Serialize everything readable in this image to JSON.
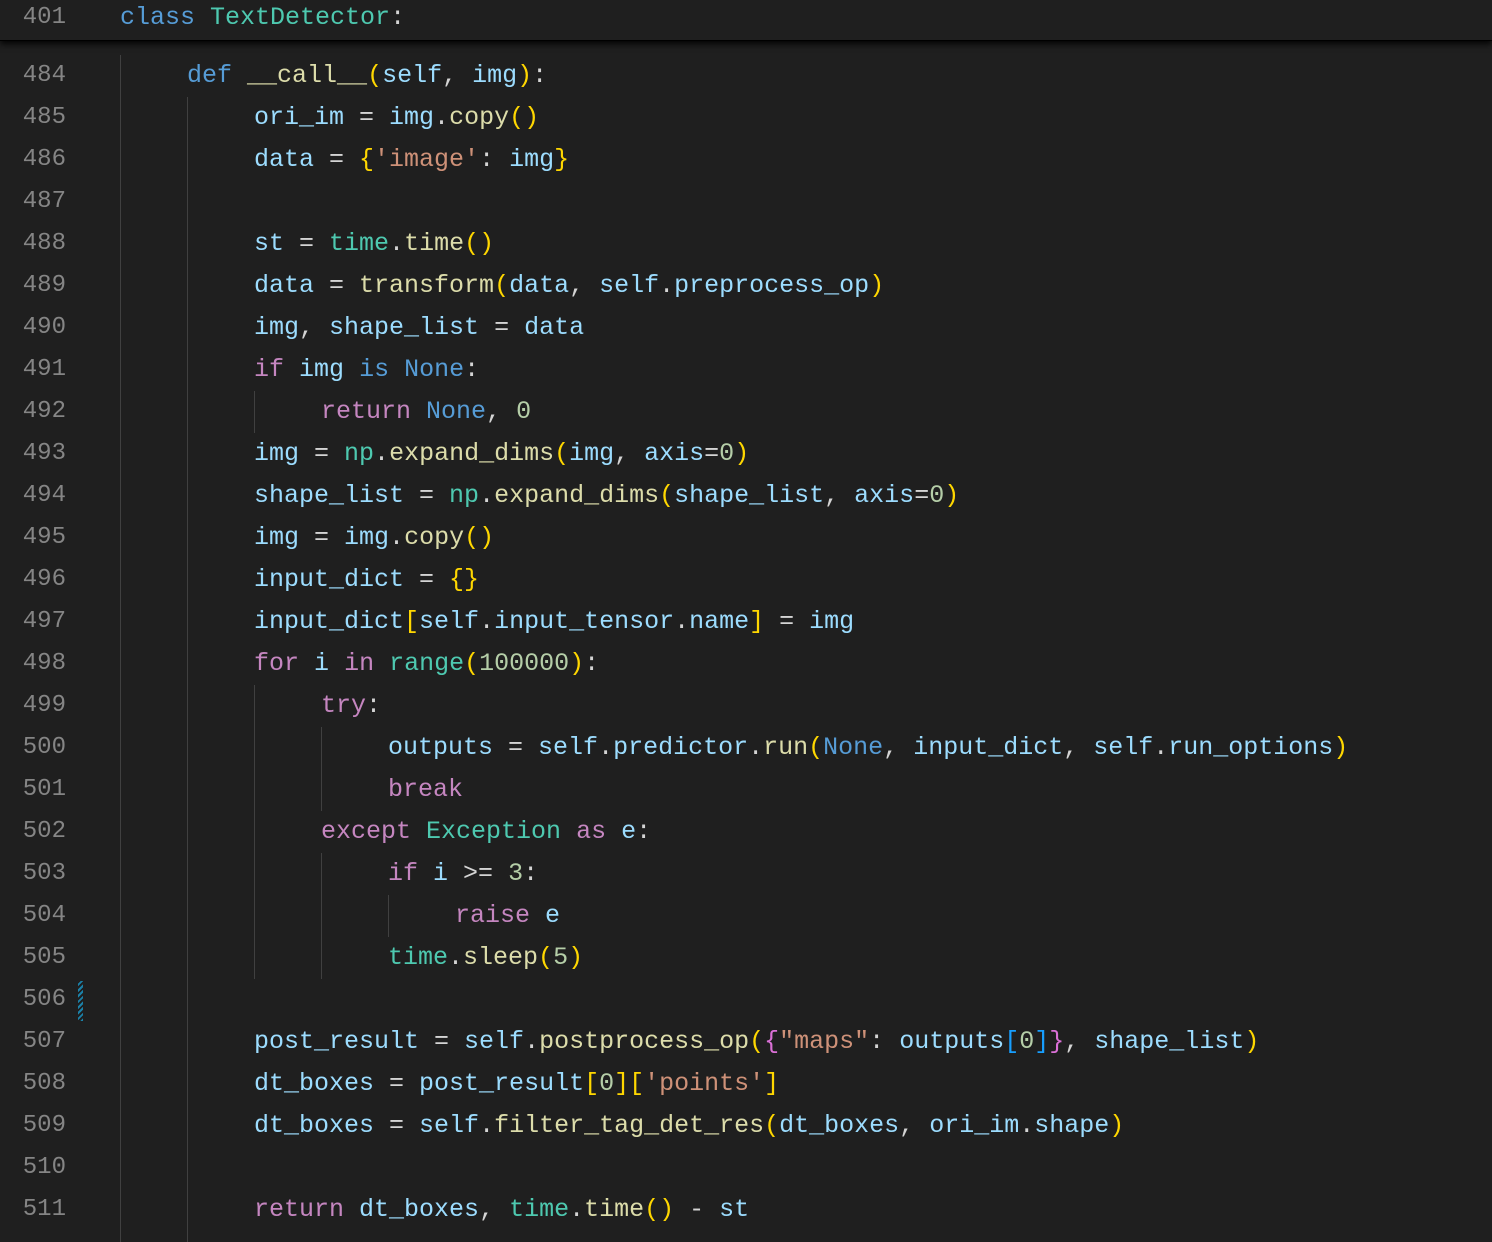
{
  "editor": {
    "sticky": [
      {
        "num": "401",
        "indent": 0,
        "tokens": [
          [
            "kb",
            "class"
          ],
          [
            "p",
            " "
          ],
          [
            "c",
            "TextDetector"
          ],
          [
            "p",
            ":"
          ]
        ]
      }
    ],
    "lines": [
      {
        "num": "484",
        "indent": 1,
        "tokens": [
          [
            "kb",
            "def"
          ],
          [
            "p",
            " "
          ],
          [
            "f",
            "__call__"
          ],
          [
            "b1",
            "("
          ],
          [
            "v",
            "self"
          ],
          [
            "p",
            ", "
          ],
          [
            "v",
            "img"
          ],
          [
            "b1",
            ")"
          ],
          [
            "p",
            ":"
          ]
        ]
      },
      {
        "num": "485",
        "indent": 2,
        "tokens": [
          [
            "v",
            "ori_im"
          ],
          [
            "p",
            " = "
          ],
          [
            "v",
            "img"
          ],
          [
            "p",
            "."
          ],
          [
            "f",
            "copy"
          ],
          [
            "b1",
            "()"
          ]
        ]
      },
      {
        "num": "486",
        "indent": 2,
        "tokens": [
          [
            "v",
            "data"
          ],
          [
            "p",
            " = "
          ],
          [
            "b1",
            "{"
          ],
          [
            "s",
            "'image'"
          ],
          [
            "p",
            ": "
          ],
          [
            "v",
            "img"
          ],
          [
            "b1",
            "}"
          ]
        ]
      },
      {
        "num": "487",
        "indent": 0,
        "tokens": []
      },
      {
        "num": "488",
        "indent": 2,
        "tokens": [
          [
            "v",
            "st"
          ],
          [
            "p",
            " = "
          ],
          [
            "c",
            "time"
          ],
          [
            "p",
            "."
          ],
          [
            "f",
            "time"
          ],
          [
            "b1",
            "()"
          ]
        ]
      },
      {
        "num": "489",
        "indent": 2,
        "tokens": [
          [
            "v",
            "data"
          ],
          [
            "p",
            " = "
          ],
          [
            "f",
            "transform"
          ],
          [
            "b1",
            "("
          ],
          [
            "v",
            "data"
          ],
          [
            "p",
            ", "
          ],
          [
            "v",
            "self"
          ],
          [
            "p",
            "."
          ],
          [
            "v",
            "preprocess_op"
          ],
          [
            "b1",
            ")"
          ]
        ]
      },
      {
        "num": "490",
        "indent": 2,
        "tokens": [
          [
            "v",
            "img"
          ],
          [
            "p",
            ", "
          ],
          [
            "v",
            "shape_list"
          ],
          [
            "p",
            " = "
          ],
          [
            "v",
            "data"
          ]
        ]
      },
      {
        "num": "491",
        "indent": 2,
        "tokens": [
          [
            "k",
            "if"
          ],
          [
            "p",
            " "
          ],
          [
            "v",
            "img"
          ],
          [
            "p",
            " "
          ],
          [
            "kb",
            "is"
          ],
          [
            "p",
            " "
          ],
          [
            "kb",
            "None"
          ],
          [
            "p",
            ":"
          ]
        ]
      },
      {
        "num": "492",
        "indent": 3,
        "tokens": [
          [
            "k",
            "return"
          ],
          [
            "p",
            " "
          ],
          [
            "kb",
            "None"
          ],
          [
            "p",
            ", "
          ],
          [
            "n",
            "0"
          ]
        ]
      },
      {
        "num": "493",
        "indent": 2,
        "tokens": [
          [
            "v",
            "img"
          ],
          [
            "p",
            " = "
          ],
          [
            "c",
            "np"
          ],
          [
            "p",
            "."
          ],
          [
            "f",
            "expand_dims"
          ],
          [
            "b1",
            "("
          ],
          [
            "v",
            "img"
          ],
          [
            "p",
            ", "
          ],
          [
            "v",
            "axis"
          ],
          [
            "p",
            "="
          ],
          [
            "n",
            "0"
          ],
          [
            "b1",
            ")"
          ]
        ]
      },
      {
        "num": "494",
        "indent": 2,
        "tokens": [
          [
            "v",
            "shape_list"
          ],
          [
            "p",
            " = "
          ],
          [
            "c",
            "np"
          ],
          [
            "p",
            "."
          ],
          [
            "f",
            "expand_dims"
          ],
          [
            "b1",
            "("
          ],
          [
            "v",
            "shape_list"
          ],
          [
            "p",
            ", "
          ],
          [
            "v",
            "axis"
          ],
          [
            "p",
            "="
          ],
          [
            "n",
            "0"
          ],
          [
            "b1",
            ")"
          ]
        ]
      },
      {
        "num": "495",
        "indent": 2,
        "tokens": [
          [
            "v",
            "img"
          ],
          [
            "p",
            " = "
          ],
          [
            "v",
            "img"
          ],
          [
            "p",
            "."
          ],
          [
            "f",
            "copy"
          ],
          [
            "b1",
            "()"
          ]
        ]
      },
      {
        "num": "496",
        "indent": 2,
        "tokens": [
          [
            "v",
            "input_dict"
          ],
          [
            "p",
            " = "
          ],
          [
            "b1",
            "{}"
          ]
        ]
      },
      {
        "num": "497",
        "indent": 2,
        "tokens": [
          [
            "v",
            "input_dict"
          ],
          [
            "b1",
            "["
          ],
          [
            "v",
            "self"
          ],
          [
            "p",
            "."
          ],
          [
            "v",
            "input_tensor"
          ],
          [
            "p",
            "."
          ],
          [
            "v",
            "name"
          ],
          [
            "b1",
            "]"
          ],
          [
            "p",
            " = "
          ],
          [
            "v",
            "img"
          ]
        ]
      },
      {
        "num": "498",
        "indent": 2,
        "tokens": [
          [
            "k",
            "for"
          ],
          [
            "p",
            " "
          ],
          [
            "v",
            "i"
          ],
          [
            "p",
            " "
          ],
          [
            "k",
            "in"
          ],
          [
            "p",
            " "
          ],
          [
            "c",
            "range"
          ],
          [
            "b1",
            "("
          ],
          [
            "n",
            "100000"
          ],
          [
            "b1",
            ")"
          ],
          [
            "p",
            ":"
          ]
        ]
      },
      {
        "num": "499",
        "indent": 3,
        "tokens": [
          [
            "k",
            "try"
          ],
          [
            "p",
            ":"
          ]
        ]
      },
      {
        "num": "500",
        "indent": 4,
        "tokens": [
          [
            "v",
            "outputs"
          ],
          [
            "p",
            " = "
          ],
          [
            "v",
            "self"
          ],
          [
            "p",
            "."
          ],
          [
            "v",
            "predictor"
          ],
          [
            "p",
            "."
          ],
          [
            "f",
            "run"
          ],
          [
            "b1",
            "("
          ],
          [
            "kb",
            "None"
          ],
          [
            "p",
            ", "
          ],
          [
            "v",
            "input_dict"
          ],
          [
            "p",
            ", "
          ],
          [
            "v",
            "self"
          ],
          [
            "p",
            "."
          ],
          [
            "v",
            "run_options"
          ],
          [
            "b1",
            ")"
          ]
        ]
      },
      {
        "num": "501",
        "indent": 4,
        "tokens": [
          [
            "k",
            "break"
          ]
        ]
      },
      {
        "num": "502",
        "indent": 3,
        "tokens": [
          [
            "k",
            "except"
          ],
          [
            "p",
            " "
          ],
          [
            "c",
            "Exception"
          ],
          [
            "p",
            " "
          ],
          [
            "k",
            "as"
          ],
          [
            "p",
            " "
          ],
          [
            "v",
            "e"
          ],
          [
            "p",
            ":"
          ]
        ]
      },
      {
        "num": "503",
        "indent": 4,
        "tokens": [
          [
            "k",
            "if"
          ],
          [
            "p",
            " "
          ],
          [
            "v",
            "i"
          ],
          [
            "p",
            " >= "
          ],
          [
            "n",
            "3"
          ],
          [
            "p",
            ":"
          ]
        ]
      },
      {
        "num": "504",
        "indent": 5,
        "tokens": [
          [
            "k",
            "raise"
          ],
          [
            "p",
            " "
          ],
          [
            "v",
            "e"
          ]
        ]
      },
      {
        "num": "505",
        "indent": 4,
        "tokens": [
          [
            "c",
            "time"
          ],
          [
            "p",
            "."
          ],
          [
            "f",
            "sleep"
          ],
          [
            "b1",
            "("
          ],
          [
            "n",
            "5"
          ],
          [
            "b1",
            ")"
          ]
        ]
      },
      {
        "num": "506",
        "indent": 0,
        "tokens": []
      },
      {
        "num": "507",
        "indent": 2,
        "tokens": [
          [
            "v",
            "post_result"
          ],
          [
            "p",
            " = "
          ],
          [
            "v",
            "self"
          ],
          [
            "p",
            "."
          ],
          [
            "f",
            "postprocess_op"
          ],
          [
            "b1",
            "("
          ],
          [
            "b2",
            "{"
          ],
          [
            "s",
            "\"maps\""
          ],
          [
            "p",
            ": "
          ],
          [
            "v",
            "outputs"
          ],
          [
            "b3",
            "["
          ],
          [
            "n",
            "0"
          ],
          [
            "b3",
            "]"
          ],
          [
            "b2",
            "}"
          ],
          [
            "p",
            ", "
          ],
          [
            "v",
            "shape_list"
          ],
          [
            "b1",
            ")"
          ]
        ]
      },
      {
        "num": "508",
        "indent": 2,
        "tokens": [
          [
            "v",
            "dt_boxes"
          ],
          [
            "p",
            " = "
          ],
          [
            "v",
            "post_result"
          ],
          [
            "b1",
            "["
          ],
          [
            "n",
            "0"
          ],
          [
            "b1",
            "]"
          ],
          [
            "b1",
            "["
          ],
          [
            "s",
            "'points'"
          ],
          [
            "b1",
            "]"
          ]
        ]
      },
      {
        "num": "509",
        "indent": 2,
        "tokens": [
          [
            "v",
            "dt_boxes"
          ],
          [
            "p",
            " = "
          ],
          [
            "v",
            "self"
          ],
          [
            "p",
            "."
          ],
          [
            "f",
            "filter_tag_det_res"
          ],
          [
            "b1",
            "("
          ],
          [
            "v",
            "dt_boxes"
          ],
          [
            "p",
            ", "
          ],
          [
            "v",
            "ori_im"
          ],
          [
            "p",
            "."
          ],
          [
            "v",
            "shape"
          ],
          [
            "b1",
            ")"
          ]
        ]
      },
      {
        "num": "510",
        "indent": 0,
        "tokens": []
      },
      {
        "num": "511",
        "indent": 2,
        "tokens": [
          [
            "k",
            "return"
          ],
          [
            "p",
            " "
          ],
          [
            "v",
            "dt_boxes"
          ],
          [
            "p",
            ", "
          ],
          [
            "c",
            "time"
          ],
          [
            "p",
            "."
          ],
          [
            "f",
            "time"
          ],
          [
            "b1",
            "()"
          ],
          [
            "p",
            " - "
          ],
          [
            "v",
            "st"
          ]
        ]
      }
    ]
  }
}
